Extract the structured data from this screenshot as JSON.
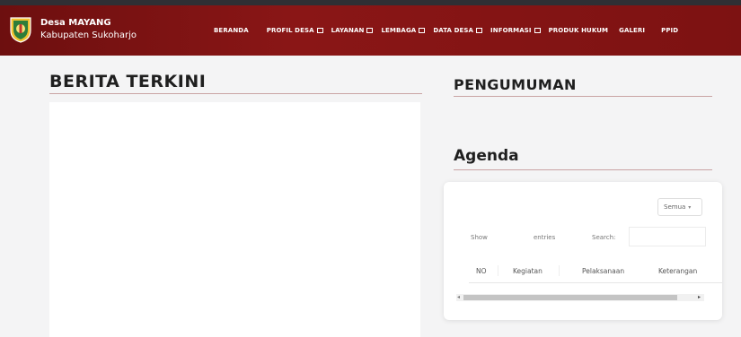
{
  "brand": {
    "line1": "Desa MAYANG",
    "line2": "Kabupaten Sukoharjo"
  },
  "nav": [
    {
      "label": "BERANDA",
      "dropdown": false
    },
    {
      "label": "PROFIL DESA",
      "dropdown": true
    },
    {
      "label": "LAYANAN",
      "dropdown": true
    },
    {
      "label": "LEMBAGA",
      "dropdown": true
    },
    {
      "label": "DATA DESA",
      "dropdown": true
    },
    {
      "label": "INFORMASI",
      "dropdown": true
    },
    {
      "label": "PRODUK HUKUM",
      "dropdown": false
    },
    {
      "label": "GALERI",
      "dropdown": false
    },
    {
      "label": "PPID",
      "dropdown": false
    }
  ],
  "colors": {
    "navbar": "#7d1212",
    "accent_line": "#c9a3a3"
  },
  "sections": {
    "berita_title": "BERITA TERKINI",
    "pengumuman_title": "PENGUMUMAN",
    "agenda_title": "Agenda"
  },
  "agenda": {
    "filter_value": "Semua",
    "show_label": "Show",
    "entries_label": "entries",
    "search_label": "Search:",
    "columns": [
      "NO",
      "Kegiatan",
      "Pelaksanaan",
      "Keterangan"
    ]
  }
}
